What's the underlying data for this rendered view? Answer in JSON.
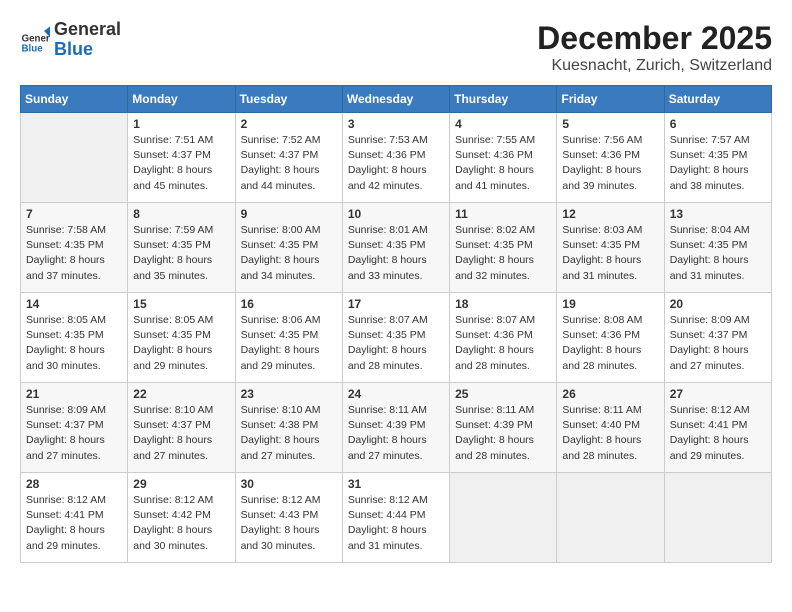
{
  "header": {
    "logo_general": "General",
    "logo_blue": "Blue",
    "title": "December 2025",
    "subtitle": "Kuesnacht, Zurich, Switzerland"
  },
  "weekdays": [
    "Sunday",
    "Monday",
    "Tuesday",
    "Wednesday",
    "Thursday",
    "Friday",
    "Saturday"
  ],
  "weeks": [
    [
      {
        "day": "",
        "empty": true
      },
      {
        "day": "1",
        "sunrise": "7:51 AM",
        "sunset": "4:37 PM",
        "daylight": "8 hours and 45 minutes."
      },
      {
        "day": "2",
        "sunrise": "7:52 AM",
        "sunset": "4:37 PM",
        "daylight": "8 hours and 44 minutes."
      },
      {
        "day": "3",
        "sunrise": "7:53 AM",
        "sunset": "4:36 PM",
        "daylight": "8 hours and 42 minutes."
      },
      {
        "day": "4",
        "sunrise": "7:55 AM",
        "sunset": "4:36 PM",
        "daylight": "8 hours and 41 minutes."
      },
      {
        "day": "5",
        "sunrise": "7:56 AM",
        "sunset": "4:36 PM",
        "daylight": "8 hours and 39 minutes."
      },
      {
        "day": "6",
        "sunrise": "7:57 AM",
        "sunset": "4:35 PM",
        "daylight": "8 hours and 38 minutes."
      }
    ],
    [
      {
        "day": "7",
        "sunrise": "7:58 AM",
        "sunset": "4:35 PM",
        "daylight": "8 hours and 37 minutes."
      },
      {
        "day": "8",
        "sunrise": "7:59 AM",
        "sunset": "4:35 PM",
        "daylight": "8 hours and 35 minutes."
      },
      {
        "day": "9",
        "sunrise": "8:00 AM",
        "sunset": "4:35 PM",
        "daylight": "8 hours and 34 minutes."
      },
      {
        "day": "10",
        "sunrise": "8:01 AM",
        "sunset": "4:35 PM",
        "daylight": "8 hours and 33 minutes."
      },
      {
        "day": "11",
        "sunrise": "8:02 AM",
        "sunset": "4:35 PM",
        "daylight": "8 hours and 32 minutes."
      },
      {
        "day": "12",
        "sunrise": "8:03 AM",
        "sunset": "4:35 PM",
        "daylight": "8 hours and 31 minutes."
      },
      {
        "day": "13",
        "sunrise": "8:04 AM",
        "sunset": "4:35 PM",
        "daylight": "8 hours and 31 minutes."
      }
    ],
    [
      {
        "day": "14",
        "sunrise": "8:05 AM",
        "sunset": "4:35 PM",
        "daylight": "8 hours and 30 minutes."
      },
      {
        "day": "15",
        "sunrise": "8:05 AM",
        "sunset": "4:35 PM",
        "daylight": "8 hours and 29 minutes."
      },
      {
        "day": "16",
        "sunrise": "8:06 AM",
        "sunset": "4:35 PM",
        "daylight": "8 hours and 29 minutes."
      },
      {
        "day": "17",
        "sunrise": "8:07 AM",
        "sunset": "4:35 PM",
        "daylight": "8 hours and 28 minutes."
      },
      {
        "day": "18",
        "sunrise": "8:07 AM",
        "sunset": "4:36 PM",
        "daylight": "8 hours and 28 minutes."
      },
      {
        "day": "19",
        "sunrise": "8:08 AM",
        "sunset": "4:36 PM",
        "daylight": "8 hours and 28 minutes."
      },
      {
        "day": "20",
        "sunrise": "8:09 AM",
        "sunset": "4:37 PM",
        "daylight": "8 hours and 27 minutes."
      }
    ],
    [
      {
        "day": "21",
        "sunrise": "8:09 AM",
        "sunset": "4:37 PM",
        "daylight": "8 hours and 27 minutes."
      },
      {
        "day": "22",
        "sunrise": "8:10 AM",
        "sunset": "4:37 PM",
        "daylight": "8 hours and 27 minutes."
      },
      {
        "day": "23",
        "sunrise": "8:10 AM",
        "sunset": "4:38 PM",
        "daylight": "8 hours and 27 minutes."
      },
      {
        "day": "24",
        "sunrise": "8:11 AM",
        "sunset": "4:39 PM",
        "daylight": "8 hours and 27 minutes."
      },
      {
        "day": "25",
        "sunrise": "8:11 AM",
        "sunset": "4:39 PM",
        "daylight": "8 hours and 28 minutes."
      },
      {
        "day": "26",
        "sunrise": "8:11 AM",
        "sunset": "4:40 PM",
        "daylight": "8 hours and 28 minutes."
      },
      {
        "day": "27",
        "sunrise": "8:12 AM",
        "sunset": "4:41 PM",
        "daylight": "8 hours and 29 minutes."
      }
    ],
    [
      {
        "day": "28",
        "sunrise": "8:12 AM",
        "sunset": "4:41 PM",
        "daylight": "8 hours and 29 minutes."
      },
      {
        "day": "29",
        "sunrise": "8:12 AM",
        "sunset": "4:42 PM",
        "daylight": "8 hours and 30 minutes."
      },
      {
        "day": "30",
        "sunrise": "8:12 AM",
        "sunset": "4:43 PM",
        "daylight": "8 hours and 30 minutes."
      },
      {
        "day": "31",
        "sunrise": "8:12 AM",
        "sunset": "4:44 PM",
        "daylight": "8 hours and 31 minutes."
      },
      {
        "day": "",
        "empty": true
      },
      {
        "day": "",
        "empty": true
      },
      {
        "day": "",
        "empty": true
      }
    ]
  ]
}
